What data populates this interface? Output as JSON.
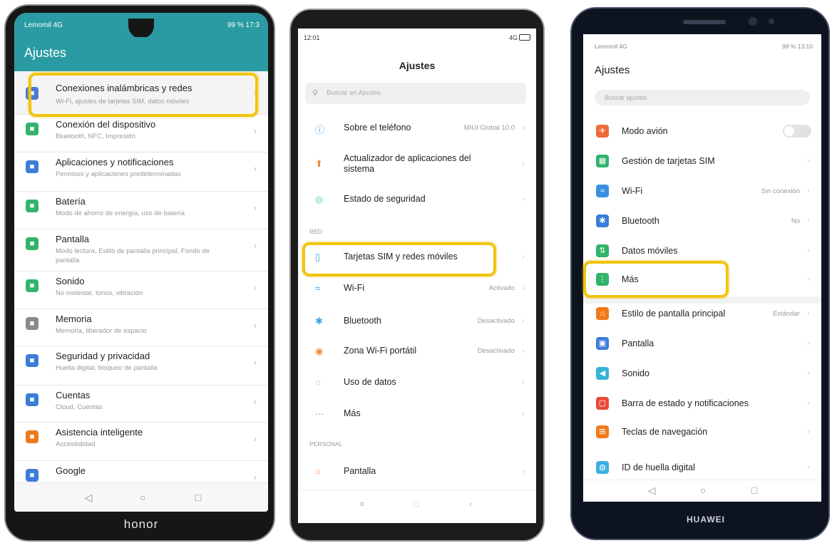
{
  "phone1": {
    "status": {
      "carrier": "Lemomil 4G",
      "right": "99 % 17:3"
    },
    "title": "Ajustes",
    "items": [
      {
        "title": "Conexiones inalámbricas y redes",
        "subtitle": "Wi-Fi, ajustes de tarjetas SIM, datos móviles",
        "icon": "wireless-icon",
        "color": "#4a7bd0"
      },
      {
        "title": "Conexión del dispositivo",
        "subtitle": "Bluetooth, NFC, Impresión",
        "icon": "device-icon",
        "color": "#33b36b"
      },
      {
        "title": "Aplicaciones y notificaciones",
        "subtitle": "Permisos y aplicaciones predeterminadas",
        "icon": "apps-icon",
        "color": "#3b7dd8"
      },
      {
        "title": "Batería",
        "subtitle": "Modo de ahorro de energía, uso de batería",
        "icon": "battery-icon",
        "color": "#33b36b"
      },
      {
        "title": "Pantalla",
        "subtitle": "Modo lectura, Estilo de pantalla principal, Fondo de pantalla",
        "icon": "display-icon",
        "color": "#33b36b"
      },
      {
        "title": "Sonido",
        "subtitle": "No molestar, tonos, vibración",
        "icon": "sound-icon",
        "color": "#33b36b"
      },
      {
        "title": "Memoria",
        "subtitle": "Memoria, liberador de espacio",
        "icon": "storage-icon",
        "color": "#8a8a8a"
      },
      {
        "title": "Seguridad y privacidad",
        "subtitle": "Huella digital, bloqueo de pantalla",
        "icon": "security-icon",
        "color": "#3b7dd8"
      },
      {
        "title": "Cuentas",
        "subtitle": "Cloud, Cuentas",
        "icon": "accounts-icon",
        "color": "#3b7dd8"
      },
      {
        "title": "Asistencia inteligente",
        "subtitle": "Accesibilidad",
        "icon": "assist-icon",
        "color": "#f07a1a"
      },
      {
        "title": "Google",
        "subtitle": "",
        "icon": "google-icon",
        "color": "#3b7dd8"
      }
    ],
    "brand": "honor"
  },
  "phone2": {
    "status": {
      "time": "12:01",
      "right": "4G"
    },
    "title": "Ajustes",
    "search_placeholder": "Buscar en Ajustes",
    "items": [
      {
        "label": "Sobre el teléfono",
        "value": "MIUI Global 10.0",
        "icon": "info-icon",
        "glyph": "ⓘ",
        "color": "#3ba4e6"
      },
      {
        "label": "Actualizador de aplicaciones del sistema",
        "value": "",
        "icon": "update-icon",
        "glyph": "⬆",
        "color": "#f08a3a"
      },
      {
        "label": "Estado de seguridad",
        "value": "",
        "icon": "shield-icon",
        "glyph": "◎",
        "color": "#45c49c"
      }
    ],
    "section_red": "RED",
    "red_items": [
      {
        "label": "Tarjetas SIM y redes móviles",
        "value": "",
        "icon": "sim-icon",
        "glyph": "▯",
        "color": "#3ba4e6"
      },
      {
        "label": "Wi-Fi",
        "value": "Activado",
        "icon": "wifi-icon",
        "glyph": "≈",
        "color": "#3ba4e6"
      },
      {
        "label": "Bluetooth",
        "value": "Desactivado",
        "icon": "bluetooth-icon",
        "glyph": "✱",
        "color": "#3ba4e6"
      },
      {
        "label": "Zona Wi-Fi portátil",
        "value": "Desactivado",
        "icon": "hotspot-icon",
        "glyph": "◉",
        "color": "#f08a3a"
      },
      {
        "label": "Uso de datos",
        "value": "",
        "icon": "data-icon",
        "glyph": "◌",
        "color": "#3ba4e6"
      },
      {
        "label": "Más",
        "value": "",
        "icon": "more-icon",
        "glyph": "···",
        "color": "#9a9a9a"
      }
    ],
    "section_personal": "PERSONAL",
    "personal_items": [
      {
        "label": "Pantalla",
        "value": "",
        "icon": "display-icon",
        "glyph": "○",
        "color": "#f08a3a"
      }
    ]
  },
  "phone3": {
    "status": {
      "carrier": "Lemomil 4G",
      "right": "99 % 13:10"
    },
    "title": "Ajustes",
    "search_placeholder": "Buscar ajustes",
    "items": [
      {
        "label": "Modo avión",
        "value": "",
        "icon": "airplane-icon",
        "glyph": "✈",
        "color": "#f06a3a",
        "toggle": true
      },
      {
        "label": "Gestión de tarjetas SIM",
        "value": "",
        "icon": "sim-icon",
        "glyph": "▦",
        "color": "#33b36b"
      },
      {
        "label": "Wi-Fi",
        "value": "Sin conexión",
        "icon": "wifi-icon",
        "glyph": "≈",
        "color": "#3b8fe0"
      },
      {
        "label": "Bluetooth",
        "value": "No",
        "icon": "bluetooth-icon",
        "glyph": "✱",
        "color": "#3b7dd8"
      },
      {
        "label": "Datos móviles",
        "value": "",
        "icon": "mobile-data-icon",
        "glyph": "⇅",
        "color": "#33b36b"
      },
      {
        "label": "Más",
        "value": "",
        "icon": "more-icon",
        "glyph": "⋮",
        "color": "#33b36b"
      }
    ],
    "items2": [
      {
        "label": "Estilo de pantalla principal",
        "value": "Estándar",
        "icon": "home-style-icon",
        "glyph": "⌂",
        "color": "#f07a1a"
      },
      {
        "label": "Pantalla",
        "value": "",
        "icon": "display-icon",
        "glyph": "▣",
        "color": "#3b7dd8"
      },
      {
        "label": "Sonido",
        "value": "",
        "icon": "sound-icon",
        "glyph": "◀",
        "color": "#33b3d8"
      },
      {
        "label": "Barra de estado y notificaciones",
        "value": "",
        "icon": "notifications-icon",
        "glyph": "▢",
        "color": "#e84a3a"
      },
      {
        "label": "Teclas de navegación",
        "value": "",
        "icon": "nav-keys-icon",
        "glyph": "⊞",
        "color": "#f07a1a"
      },
      {
        "label": "ID de huella digital",
        "value": "",
        "icon": "fingerprint-icon",
        "glyph": "◍",
        "color": "#3bb0e0"
      }
    ],
    "brand": "HUAWEI"
  }
}
